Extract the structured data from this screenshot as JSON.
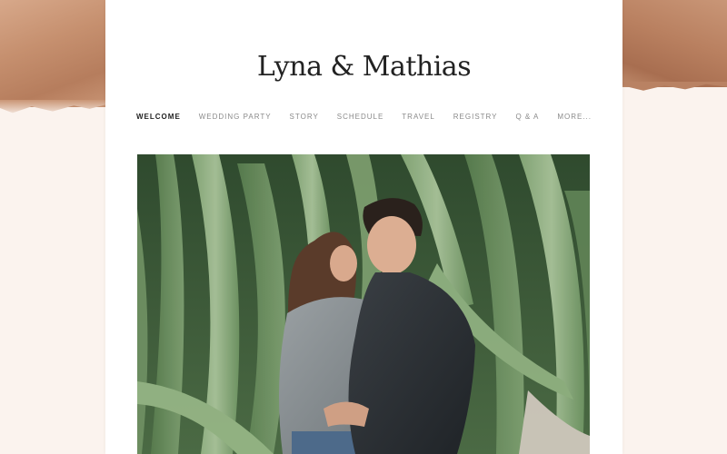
{
  "site": {
    "title": "Lyna & Mathias"
  },
  "nav": {
    "items": [
      {
        "label": "WELCOME",
        "active": true
      },
      {
        "label": "WEDDING PARTY",
        "active": false
      },
      {
        "label": "STORY",
        "active": false
      },
      {
        "label": "SCHEDULE",
        "active": false
      },
      {
        "label": "TRAVEL",
        "active": false
      },
      {
        "label": "REGISTRY",
        "active": false
      },
      {
        "label": "Q & A",
        "active": false
      },
      {
        "label": "MORE...",
        "active": false
      }
    ]
  },
  "colors": {
    "background": "#fbf3ee",
    "accent_copper": "#c48d6c",
    "card": "#ffffff",
    "title_text": "#222222",
    "nav_inactive": "#8a8a8a",
    "foliage": "#6f9463"
  },
  "hero": {
    "subject": "couple-embracing-in-front-of-cactus-photo"
  }
}
